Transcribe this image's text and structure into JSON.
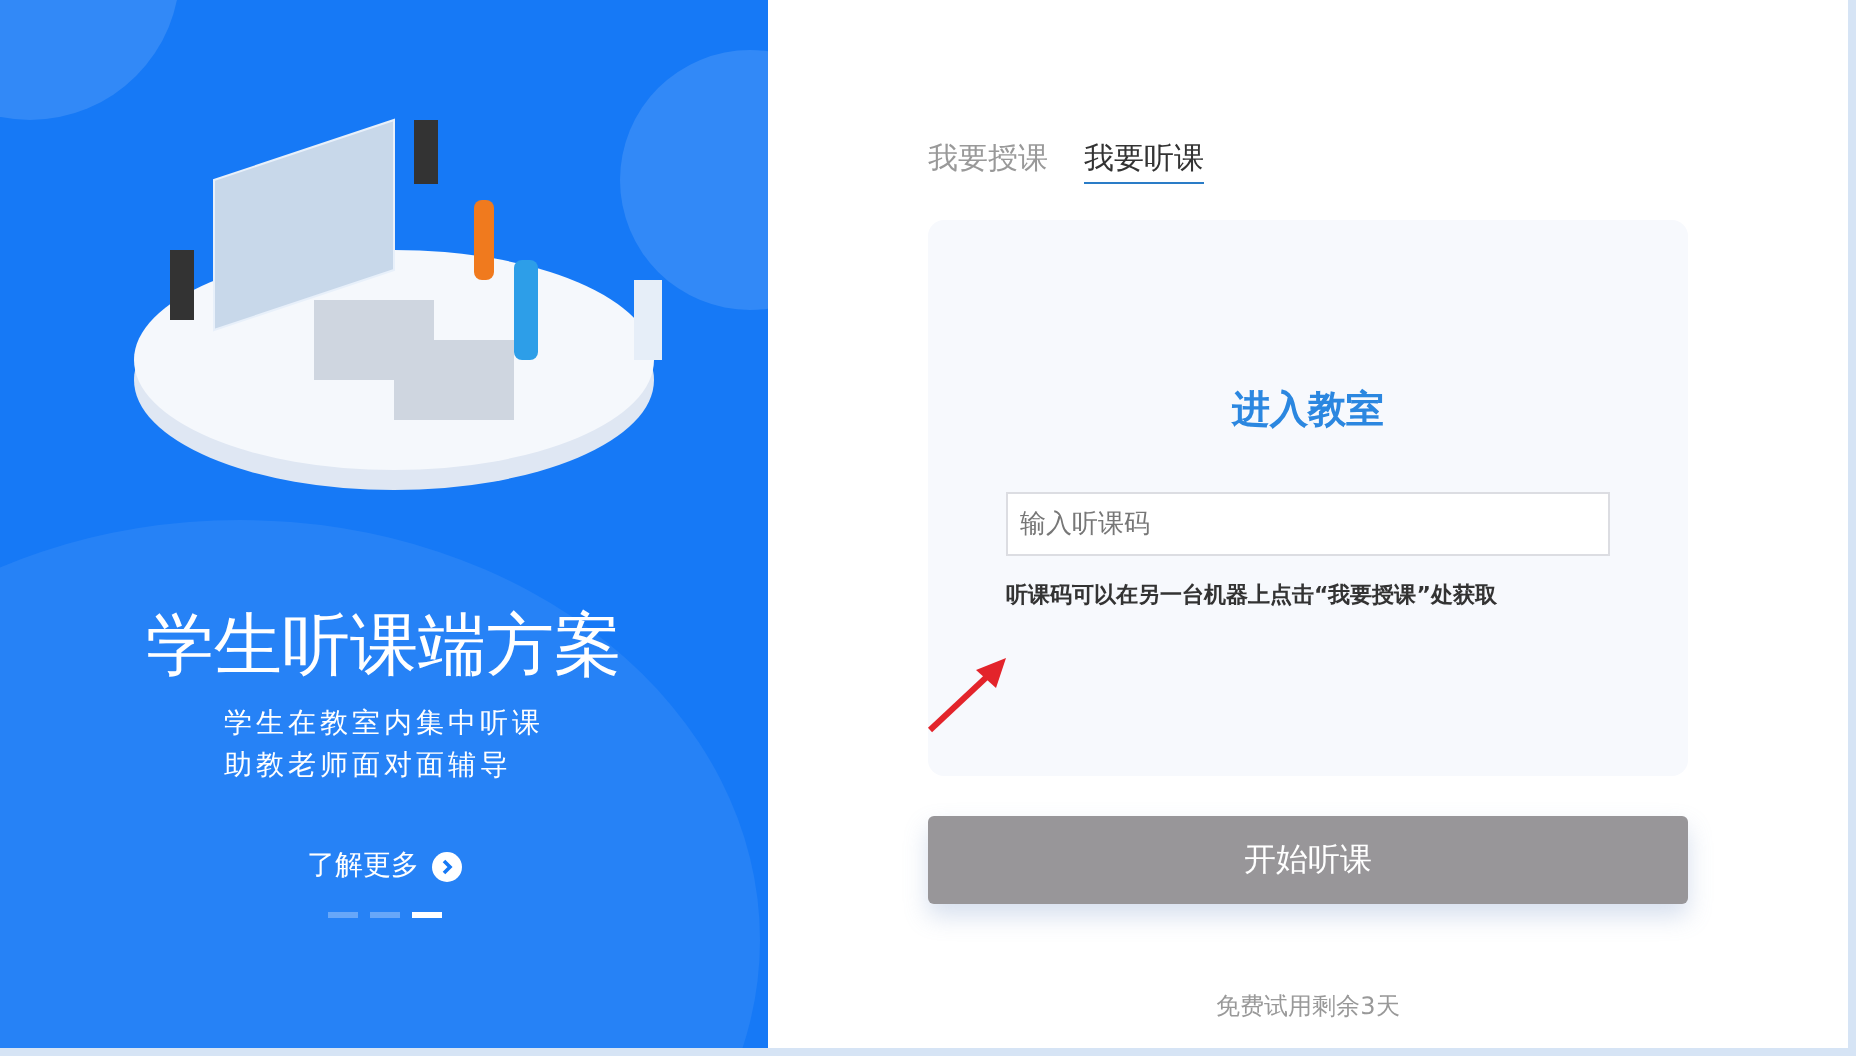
{
  "promo": {
    "title": "学生听课端方案",
    "lines": [
      "学生在教室内集中听课",
      "助教老师面对面辅导"
    ],
    "more_link": "了解更多",
    "dots": [
      {
        "selected": false
      },
      {
        "selected": false
      },
      {
        "selected": true
      }
    ]
  },
  "tabs": [
    {
      "label": "我要授课",
      "selected": false
    },
    {
      "label": "我要听课",
      "selected": true
    }
  ],
  "card": {
    "heading": "进入教室",
    "code_field": {
      "placeholder": "输入听课码"
    },
    "hint": "听课码可以在另一台机器上点击“我要授课”处获取"
  },
  "start_button": {
    "label": "开始听课",
    "disabled": true
  },
  "trial_note": "免费试用剩余3天"
}
